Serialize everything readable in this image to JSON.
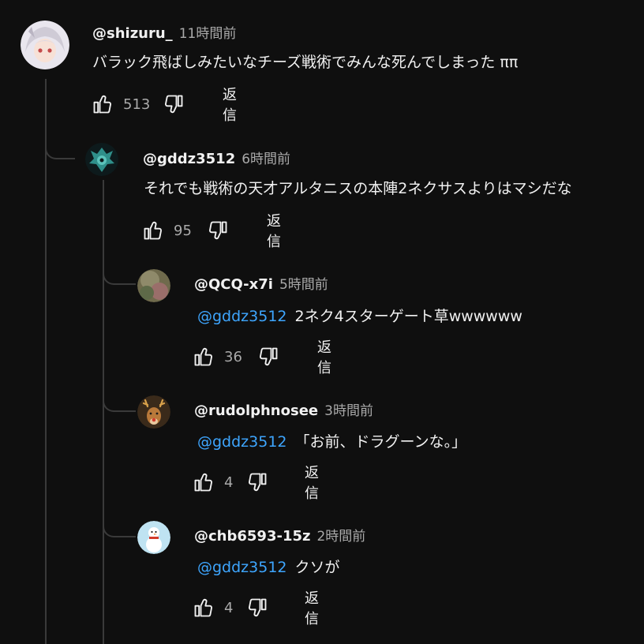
{
  "comments": [
    {
      "handle": "@shizuru_",
      "time": "11時間前",
      "mention": "",
      "text": "バラック飛ばしみたいなチーズ戦術でみんな死んでしまった ππ",
      "likes": "513",
      "reply_label": "返信",
      "avatar_icon": "anime-girl-avatar"
    },
    {
      "handle": "@gddz3512",
      "time": "6時間前",
      "mention": "",
      "text": "それでも戦術の天才アルタニスの本陣2ネクサスよりはマシだな",
      "likes": "95",
      "reply_label": "返信",
      "avatar_icon": "teal-dragon-avatar"
    },
    {
      "handle": "@QCQ-x7i",
      "time": "5時間前",
      "mention": "@gddz3512",
      "text": "2ネク4スターゲート草wwwwww",
      "likes": "36",
      "reply_label": "返信",
      "avatar_icon": "blurred-photo-avatar"
    },
    {
      "handle": "@rudolphnosee",
      "time": "3時間前",
      "mention": "@gddz3512",
      "text": "「お前、ドラグーンな。」",
      "likes": "4",
      "reply_label": "返信",
      "avatar_icon": "reindeer-avatar"
    },
    {
      "handle": "@chb6593-15z",
      "time": "2時間前",
      "mention": "@gddz3512",
      "text": "クソが",
      "likes": "4",
      "reply_label": "返信",
      "avatar_icon": "snowman-avatar"
    }
  ],
  "colors": {
    "background": "#0f0f0f",
    "text": "#f1f1f1",
    "muted": "#aaaaaa",
    "mention": "#3ea6ff",
    "thread_line": "#3a3a3a"
  }
}
